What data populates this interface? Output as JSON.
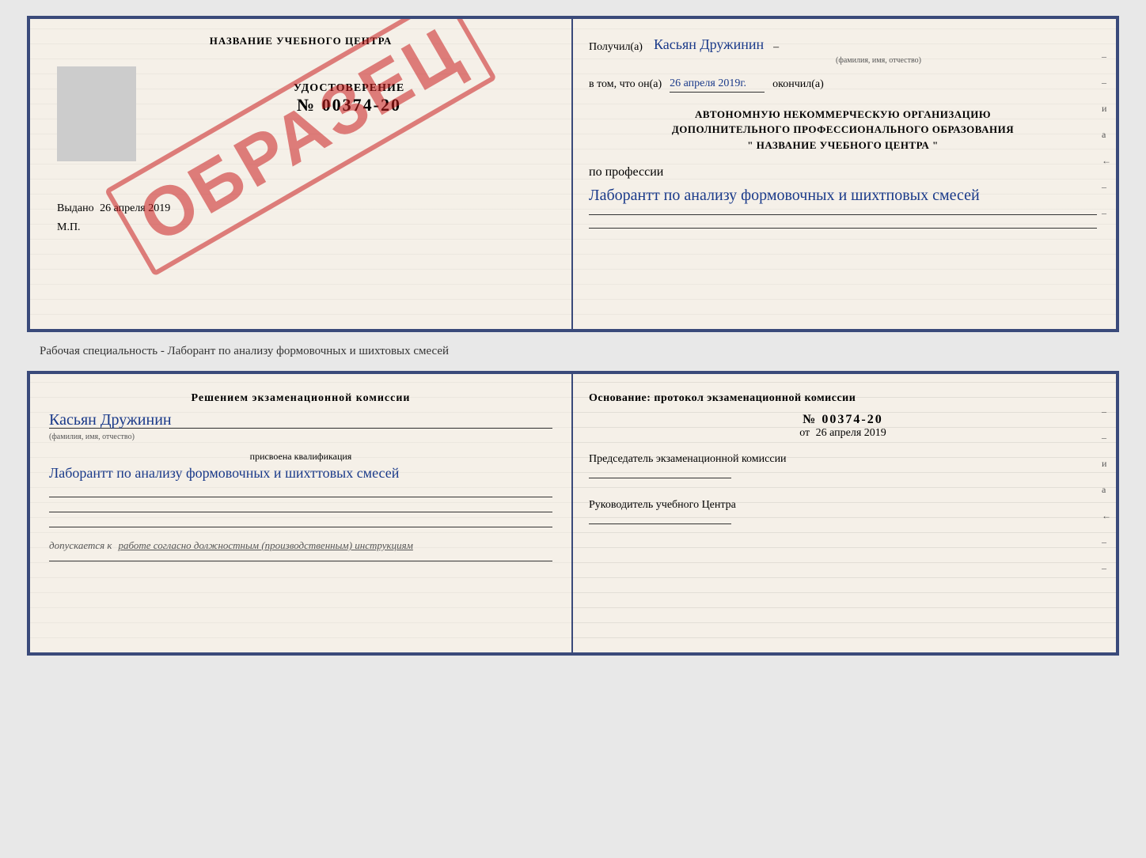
{
  "top_doc": {
    "left": {
      "title": "НАЗВАНИЕ УЧЕБНОГО ЦЕНТРА",
      "watermark": "ОБРАЗЕЦ",
      "cert_label": "УДОСТОВЕРЕНИЕ",
      "cert_number": "№ 00374-20",
      "issued_label": "Выдано",
      "issued_date": "26 апреля 2019",
      "mp_label": "М.П."
    },
    "right": {
      "received_label": "Получил(а)",
      "received_name": "Касьян Дружинин",
      "name_subtitle": "(фамилия, имя, отчество)",
      "date_label": "в том, что он(а)",
      "date_value": "26 апреля 2019г.",
      "completed_label": "окончил(а)",
      "org_line1": "АВТОНОМНУЮ НЕКОММЕРЧЕСКУЮ ОРГАНИЗАЦИЮ",
      "org_line2": "ДОПОЛНИТЕЛЬНОГО ПРОФЕССИОНАЛЬНОГО ОБРАЗОВАНИЯ",
      "org_line3": "\"   НАЗВАНИЕ УЧЕБНОГО ЦЕНТРА   \"",
      "profession_label": "по профессии",
      "profession_handwritten": "Лаборантт по анализу формовочных и шихтповых смесей",
      "side_chars": [
        "–",
        "–",
        "и",
        "а",
        "←",
        "–",
        "–"
      ]
    }
  },
  "caption": "Рабочая специальность - Лаборант по анализу формовочных и шихтовых смесей",
  "bottom_doc": {
    "left": {
      "title": "Решением  экзаменационной  комиссии",
      "name_handwritten": "Касьян  Дружинин",
      "name_subtitle": "(фамилия, имя, отчество)",
      "qual_label": "присвоена квалификация",
      "qual_handwritten": "Лаборантт по анализу формовочных и шихттовых смесей",
      "допуск_label": "допускается к",
      "допуск_text": "работе согласно должностным (производственным) инструкциям"
    },
    "right": {
      "basis_label": "Основание: протокол экзаменационной  комиссии",
      "protocol_number": "№  00374-20",
      "date_prefix": "от",
      "date_value": "26 апреля 2019",
      "chairman_label": "Председатель экзаменационной комиссии",
      "director_label": "Руководитель учебного Центра",
      "side_chars": [
        "–",
        "–",
        "и",
        "а",
        "←",
        "–",
        "–"
      ]
    }
  }
}
